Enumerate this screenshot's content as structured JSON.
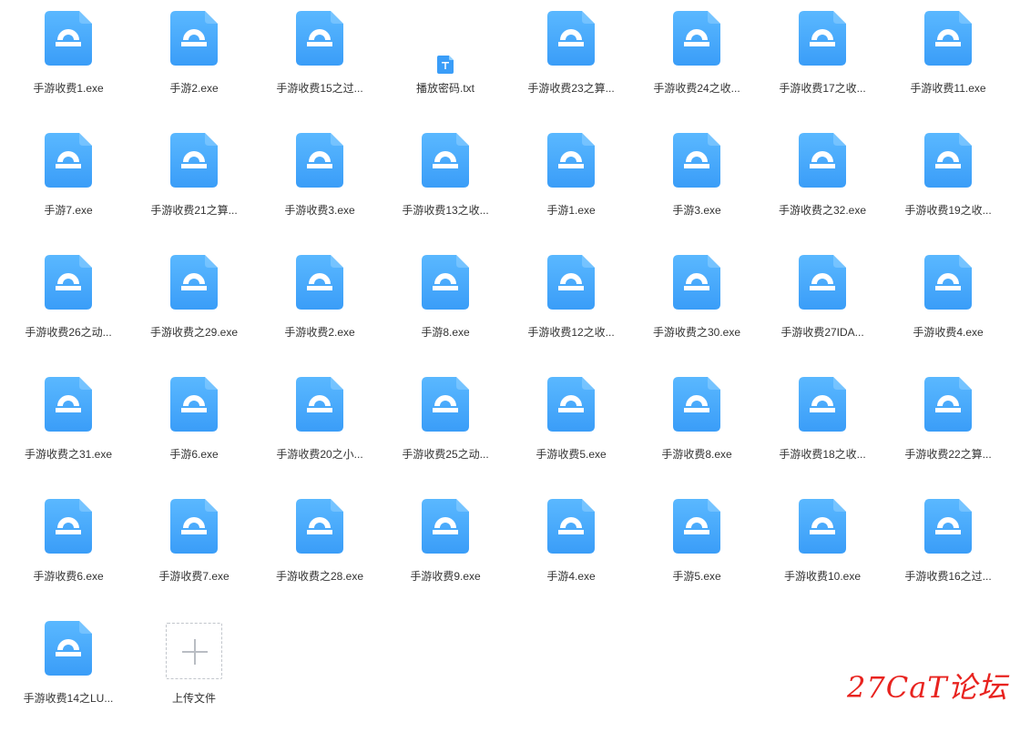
{
  "files": [
    {
      "name": "手游收费1.exe",
      "type": "exe"
    },
    {
      "name": "手游2.exe",
      "type": "exe"
    },
    {
      "name": "手游收费15之过...",
      "type": "exe"
    },
    {
      "name": "播放密码.txt",
      "type": "txt"
    },
    {
      "name": "手游收费23之算...",
      "type": "exe"
    },
    {
      "name": "手游收费24之收...",
      "type": "exe"
    },
    {
      "name": "手游收费17之收...",
      "type": "exe"
    },
    {
      "name": "手游收费11.exe",
      "type": "exe"
    },
    {
      "name": "手游7.exe",
      "type": "exe"
    },
    {
      "name": "手游收费21之算...",
      "type": "exe"
    },
    {
      "name": "手游收费3.exe",
      "type": "exe"
    },
    {
      "name": "手游收费13之收...",
      "type": "exe"
    },
    {
      "name": "手游1.exe",
      "type": "exe"
    },
    {
      "name": "手游3.exe",
      "type": "exe"
    },
    {
      "name": "手游收费之32.exe",
      "type": "exe"
    },
    {
      "name": "手游收费19之收...",
      "type": "exe"
    },
    {
      "name": "手游收费26之动...",
      "type": "exe"
    },
    {
      "name": "手游收费之29.exe",
      "type": "exe"
    },
    {
      "name": "手游收费2.exe",
      "type": "exe"
    },
    {
      "name": "手游8.exe",
      "type": "exe"
    },
    {
      "name": "手游收费12之收...",
      "type": "exe"
    },
    {
      "name": "手游收费之30.exe",
      "type": "exe"
    },
    {
      "name": "手游收费27IDA...",
      "type": "exe"
    },
    {
      "name": "手游收费4.exe",
      "type": "exe"
    },
    {
      "name": "手游收费之31.exe",
      "type": "exe"
    },
    {
      "name": "手游6.exe",
      "type": "exe"
    },
    {
      "name": "手游收费20之小...",
      "type": "exe"
    },
    {
      "name": "手游收费25之动...",
      "type": "exe"
    },
    {
      "name": "手游收费5.exe",
      "type": "exe"
    },
    {
      "name": "手游收费8.exe",
      "type": "exe"
    },
    {
      "name": "手游收费18之收...",
      "type": "exe"
    },
    {
      "name": "手游收费22之算...",
      "type": "exe"
    },
    {
      "name": "手游收费6.exe",
      "type": "exe"
    },
    {
      "name": "手游收费7.exe",
      "type": "exe"
    },
    {
      "name": "手游收费之28.exe",
      "type": "exe"
    },
    {
      "name": "手游收费9.exe",
      "type": "exe"
    },
    {
      "name": "手游4.exe",
      "type": "exe"
    },
    {
      "name": "手游5.exe",
      "type": "exe"
    },
    {
      "name": "手游收费10.exe",
      "type": "exe"
    },
    {
      "name": "手游收费16之过...",
      "type": "exe"
    },
    {
      "name": "手游收费14之LU...",
      "type": "exe"
    }
  ],
  "upload": {
    "label": "上传文件",
    "icon": "plus-icon"
  },
  "watermark": "27CaT论坛",
  "colors": {
    "exe_icon_top": "#5ab8ff",
    "exe_icon_bottom": "#3a9df8",
    "txt_icon": "#3a9df8",
    "label_text": "#333333",
    "watermark": "#e8231f"
  }
}
